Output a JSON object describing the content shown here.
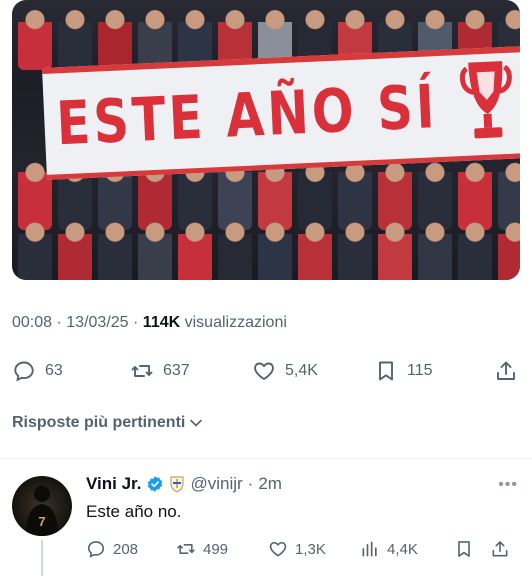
{
  "tweet": {
    "time": "00:08",
    "date": "13/03/25",
    "views_count": "114K",
    "views_label": "visualizzazioni",
    "media": {
      "banner_text": "ESTE AÑO SÍ",
      "colors": {
        "banner_red": "#d9303a",
        "banner_bg": "#eef0f4"
      }
    },
    "stats": {
      "replies": "63",
      "retweets": "637",
      "likes": "5,4K",
      "bookmarks": "115"
    }
  },
  "replies_section": {
    "title": "Risposte più pertinenti"
  },
  "reply": {
    "name": "Vini Jr.",
    "handle": "@vinijr",
    "time": "2m",
    "text": "Este año no.",
    "avatar_number": "7",
    "stats": {
      "replies": "208",
      "retweets": "499",
      "likes": "1,3K",
      "views": "4,4K"
    }
  },
  "icons": {
    "reply": "reply-bubble-icon",
    "retweet": "retweet-icon",
    "like": "heart-icon",
    "bookmark": "bookmark-icon",
    "share": "share-icon",
    "views": "bar-chart-icon",
    "verified": "verified-badge-icon",
    "affiliate": "club-crest-icon",
    "more": "more-dots-icon"
  },
  "colors": {
    "text_primary": "#0f1419",
    "text_secondary": "#536471",
    "verified_blue": "#1d9bf0"
  }
}
